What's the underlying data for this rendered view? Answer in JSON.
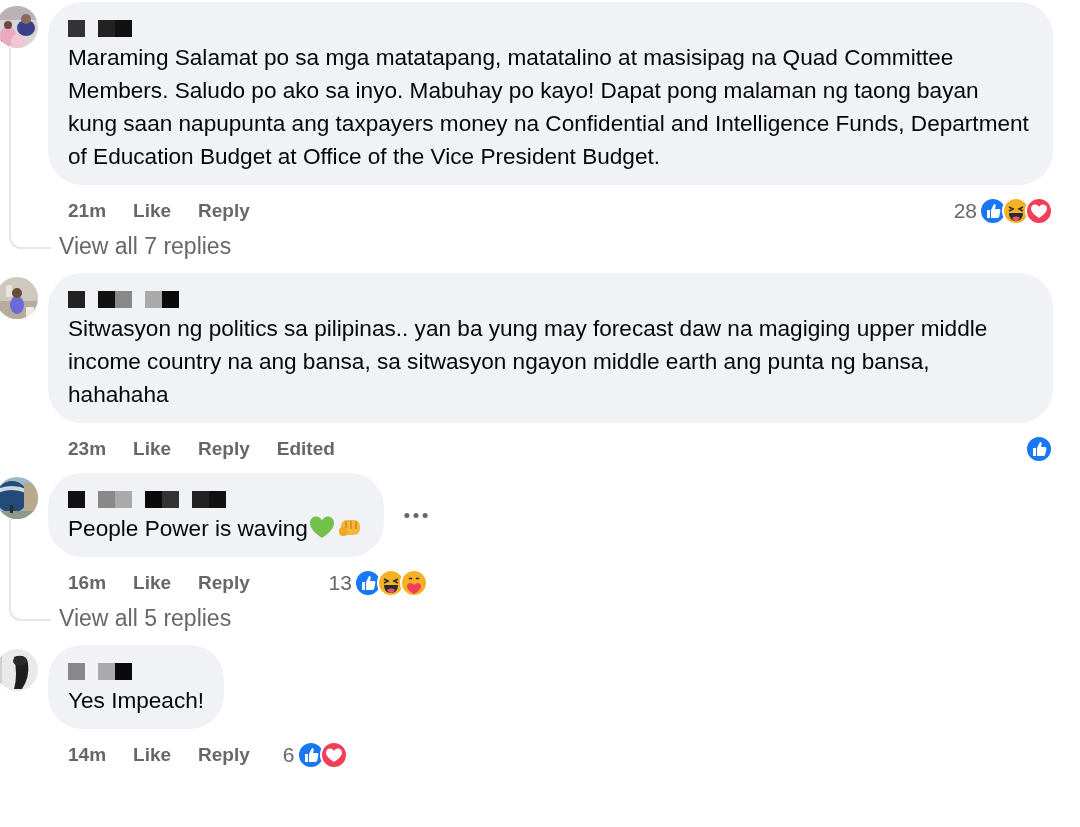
{
  "comments": [
    {
      "avatar": {
        "kind": "picture"
      },
      "author_redacted": true,
      "text": "Maraming Salamat po sa mga matatapang, matatalino at masisipag na Quad Committee Members. Saludo po ako sa inyo. Mabuhay po kayo! Dapat pong malaman ng taong bayan kung saan napupunta ang taxpayers money na Confidential and Intelligence Funds, Department of Education Budget at Office of the Vice President Budget.",
      "menu_shown": false,
      "time": "21m",
      "actions": [
        "Like",
        "Reply"
      ],
      "reaction_count": "28",
      "reactions": [
        {
          "kind": "like"
        },
        {
          "kind": "haha"
        },
        {
          "kind": "love"
        }
      ],
      "replies_link": "View all 7 replies"
    },
    {
      "avatar": {
        "kind": "picture"
      },
      "author_redacted": true,
      "text": "Sitwasyon ng politics sa pilipinas.. yan ba yung may forecast daw na magiging upper middle income country na ang bansa, sa sitwasyon ngayon middle earth ang punta ng bansa, hahahaha",
      "menu_shown": false,
      "time": "23m",
      "actions": [
        "Like",
        "Reply"
      ],
      "edited_label": "Edited",
      "reactions": [
        {
          "kind": "like"
        }
      ]
    },
    {
      "avatar": {
        "kind": "picture"
      },
      "author_redacted": true,
      "text": "People Power is waving",
      "emojis": [
        {
          "kind": "green_heart"
        },
        {
          "kind": "fist"
        }
      ],
      "menu_shown": true,
      "time": "16m",
      "actions": [
        "Like",
        "Reply"
      ],
      "reaction_count": "13",
      "reactions": [
        {
          "kind": "like"
        },
        {
          "kind": "haha"
        },
        {
          "kind": "care"
        }
      ],
      "replies_link": "View all 5 replies"
    },
    {
      "avatar": {
        "kind": "picture"
      },
      "author_redacted": true,
      "text": "Yes Impeach!",
      "menu_shown": false,
      "time": "14m",
      "actions": [
        "Like",
        "Reply"
      ],
      "reaction_count": "6",
      "reactions": [
        {
          "kind": "like"
        },
        {
          "kind": "love"
        }
      ]
    }
  ]
}
